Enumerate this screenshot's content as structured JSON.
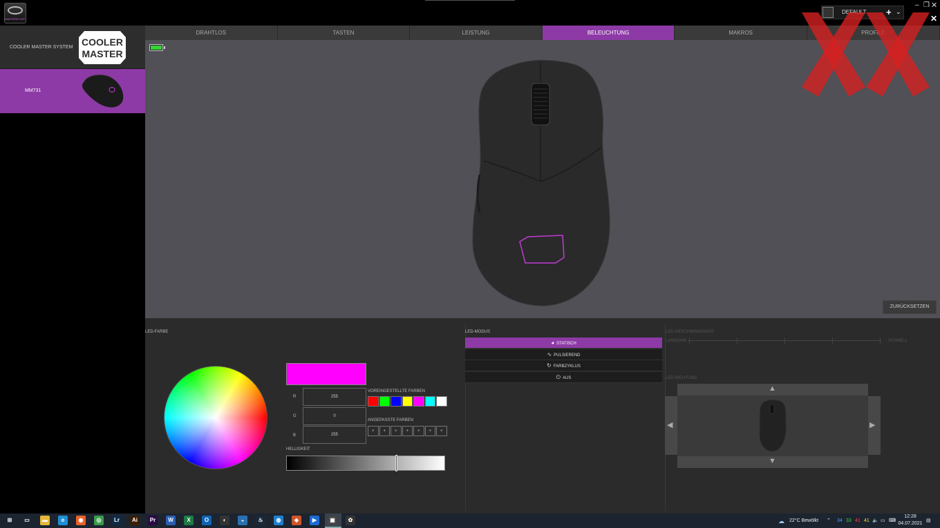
{
  "app": {
    "logo_text": "MASTERPLUS+",
    "profile": {
      "name": "DEFAULT"
    },
    "window_controls": {
      "minimize": "–",
      "maximize": "❐",
      "close": "✕"
    }
  },
  "sidebar": {
    "system_label": "COOLER MASTER SYSTEM",
    "brand_logo_text": [
      "COOLER",
      "MASTER"
    ],
    "device_label": "MM731"
  },
  "tabs": [
    {
      "label": "DRAHTLOS",
      "active": false
    },
    {
      "label": "TASTEN",
      "active": false
    },
    {
      "label": "LEISTUNG",
      "active": false
    },
    {
      "label": "BELEUCHTUNG",
      "active": true
    },
    {
      "label": "MAKROS",
      "active": false
    },
    {
      "label": "PROFILE",
      "active": false
    }
  ],
  "preview": {
    "battery_level": 0.9,
    "reset_label": "ZURÜCKSETZEN"
  },
  "led_color": {
    "section_label": "LED-FARBE",
    "current_color": "#ff00ff",
    "r_label": "R",
    "r_value": "255",
    "g_label": "G",
    "g_value": "0",
    "b_label": "B",
    "b_value": "255",
    "preset_label": "VOREINGESTELLTE FARBEN",
    "presets": [
      "#ff0000",
      "#00ff00",
      "#0000ff",
      "#ffff00",
      "#ff00ff",
      "#00ffff",
      "#ffffff"
    ],
    "custom_label": "ANGEPASSTE FARBEN",
    "custom_slots": [
      "+",
      "+",
      "+",
      "+",
      "+",
      "+",
      "+"
    ],
    "brightness_label": "HELLIGKEIT",
    "brightness": 0.69
  },
  "led_mode": {
    "section_label": "LED-MODUS",
    "modes": [
      {
        "label": "STATISCH",
        "icon": "palette-icon",
        "glyph": "◕",
        "active": true
      },
      {
        "label": "PULSIEREND",
        "icon": "pulse-icon",
        "glyph": "∿",
        "active": false
      },
      {
        "label": "FARBZYKLUS",
        "icon": "cycle-icon",
        "glyph": "↻",
        "active": false
      },
      {
        "label": "AUS",
        "icon": "power-icon",
        "glyph": "⏻",
        "active": false
      }
    ]
  },
  "led_speed": {
    "section_label": "LED-GESCHWINDIGKEIT",
    "min_label": "LANGSAM",
    "max_label": "SCHNELL"
  },
  "led_direction": {
    "section_label": "LED-RICHTUNG"
  },
  "taskbar": {
    "weather": "22°C  Bewölkt",
    "clock_time": "12:28",
    "clock_date": "04.07.2021",
    "tray_numbers": [
      "34",
      "33",
      "41",
      "41"
    ],
    "apps": [
      {
        "name": "windows-start-icon",
        "glyph": "⊞",
        "color": "transparent"
      },
      {
        "name": "task-view-icon",
        "glyph": "▭",
        "color": "transparent"
      },
      {
        "name": "file-explorer-icon",
        "glyph": "▬",
        "color": "#e8b73a"
      },
      {
        "name": "edge-icon",
        "glyph": "e",
        "color": "#1f8fd6"
      },
      {
        "name": "firefox-icon",
        "glyph": "◉",
        "color": "#e8622a"
      },
      {
        "name": "chrome-icon",
        "glyph": "◎",
        "color": "#3b9c4a"
      },
      {
        "name": "lightroom-icon",
        "glyph": "Lr",
        "color": "#0f2a44"
      },
      {
        "name": "illustrator-icon",
        "glyph": "Ai",
        "color": "#3a1e00"
      },
      {
        "name": "premiere-icon",
        "glyph": "Pr",
        "color": "#2a0a44"
      },
      {
        "name": "word-icon",
        "glyph": "W",
        "color": "#2b5fb3"
      },
      {
        "name": "excel-icon",
        "glyph": "X",
        "color": "#1e7a44"
      },
      {
        "name": "outlook-icon",
        "glyph": "O",
        "color": "#0f64b4"
      },
      {
        "name": "app-icon-1",
        "glyph": "◐",
        "color": "#333"
      },
      {
        "name": "app-icon-2",
        "glyph": "◒",
        "color": "#2a6fb0"
      },
      {
        "name": "steam-icon",
        "glyph": "♨",
        "color": "#1b2838"
      },
      {
        "name": "app-icon-3",
        "glyph": "◍",
        "color": "#1c7fd0"
      },
      {
        "name": "app-icon-4",
        "glyph": "◆",
        "color": "#d0552a"
      },
      {
        "name": "app-icon-5",
        "glyph": "▶",
        "color": "#1d6ad0"
      },
      {
        "name": "masterplus-icon",
        "glyph": "▣",
        "color": "#444"
      },
      {
        "name": "app-icon-6",
        "glyph": "✿",
        "color": "#333"
      }
    ]
  }
}
